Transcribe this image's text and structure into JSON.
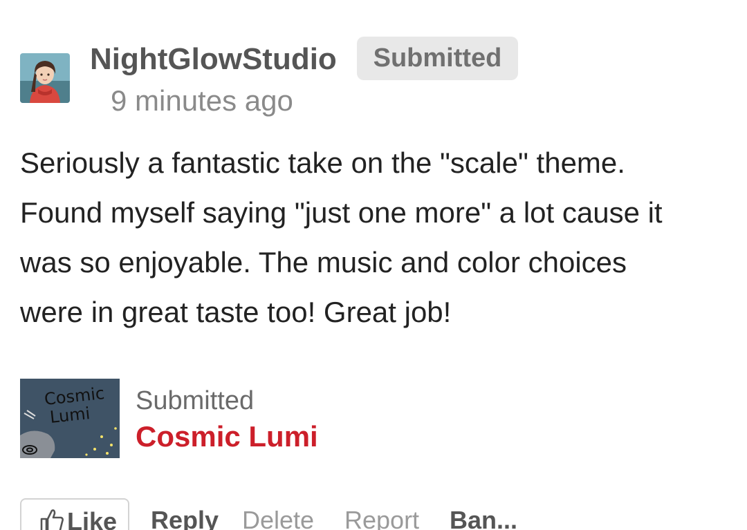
{
  "comment": {
    "author": "NightGlowStudio",
    "badge": "Submitted",
    "timestamp": "9 minutes ago",
    "body_lines": [
      "Seriously a fantastic take on the \"scale\" theme.",
      "Found myself saying \"just one more\" a lot cause it",
      "was so enjoyable. The music and color choices",
      "were in great taste too! Great job!"
    ]
  },
  "submission": {
    "label": "Submitted",
    "title": "Cosmic Lumi",
    "thumbnail_text": [
      "Cosmic",
      "Lumi"
    ],
    "title_color": "#cc1f2a"
  },
  "actions": {
    "like": "Like",
    "reply": "Reply",
    "delete": "Delete",
    "report": "Report",
    "ban": "Ban..."
  },
  "icons": {
    "avatar": "user-avatar-illustration",
    "like": "thumbs-up-icon"
  }
}
